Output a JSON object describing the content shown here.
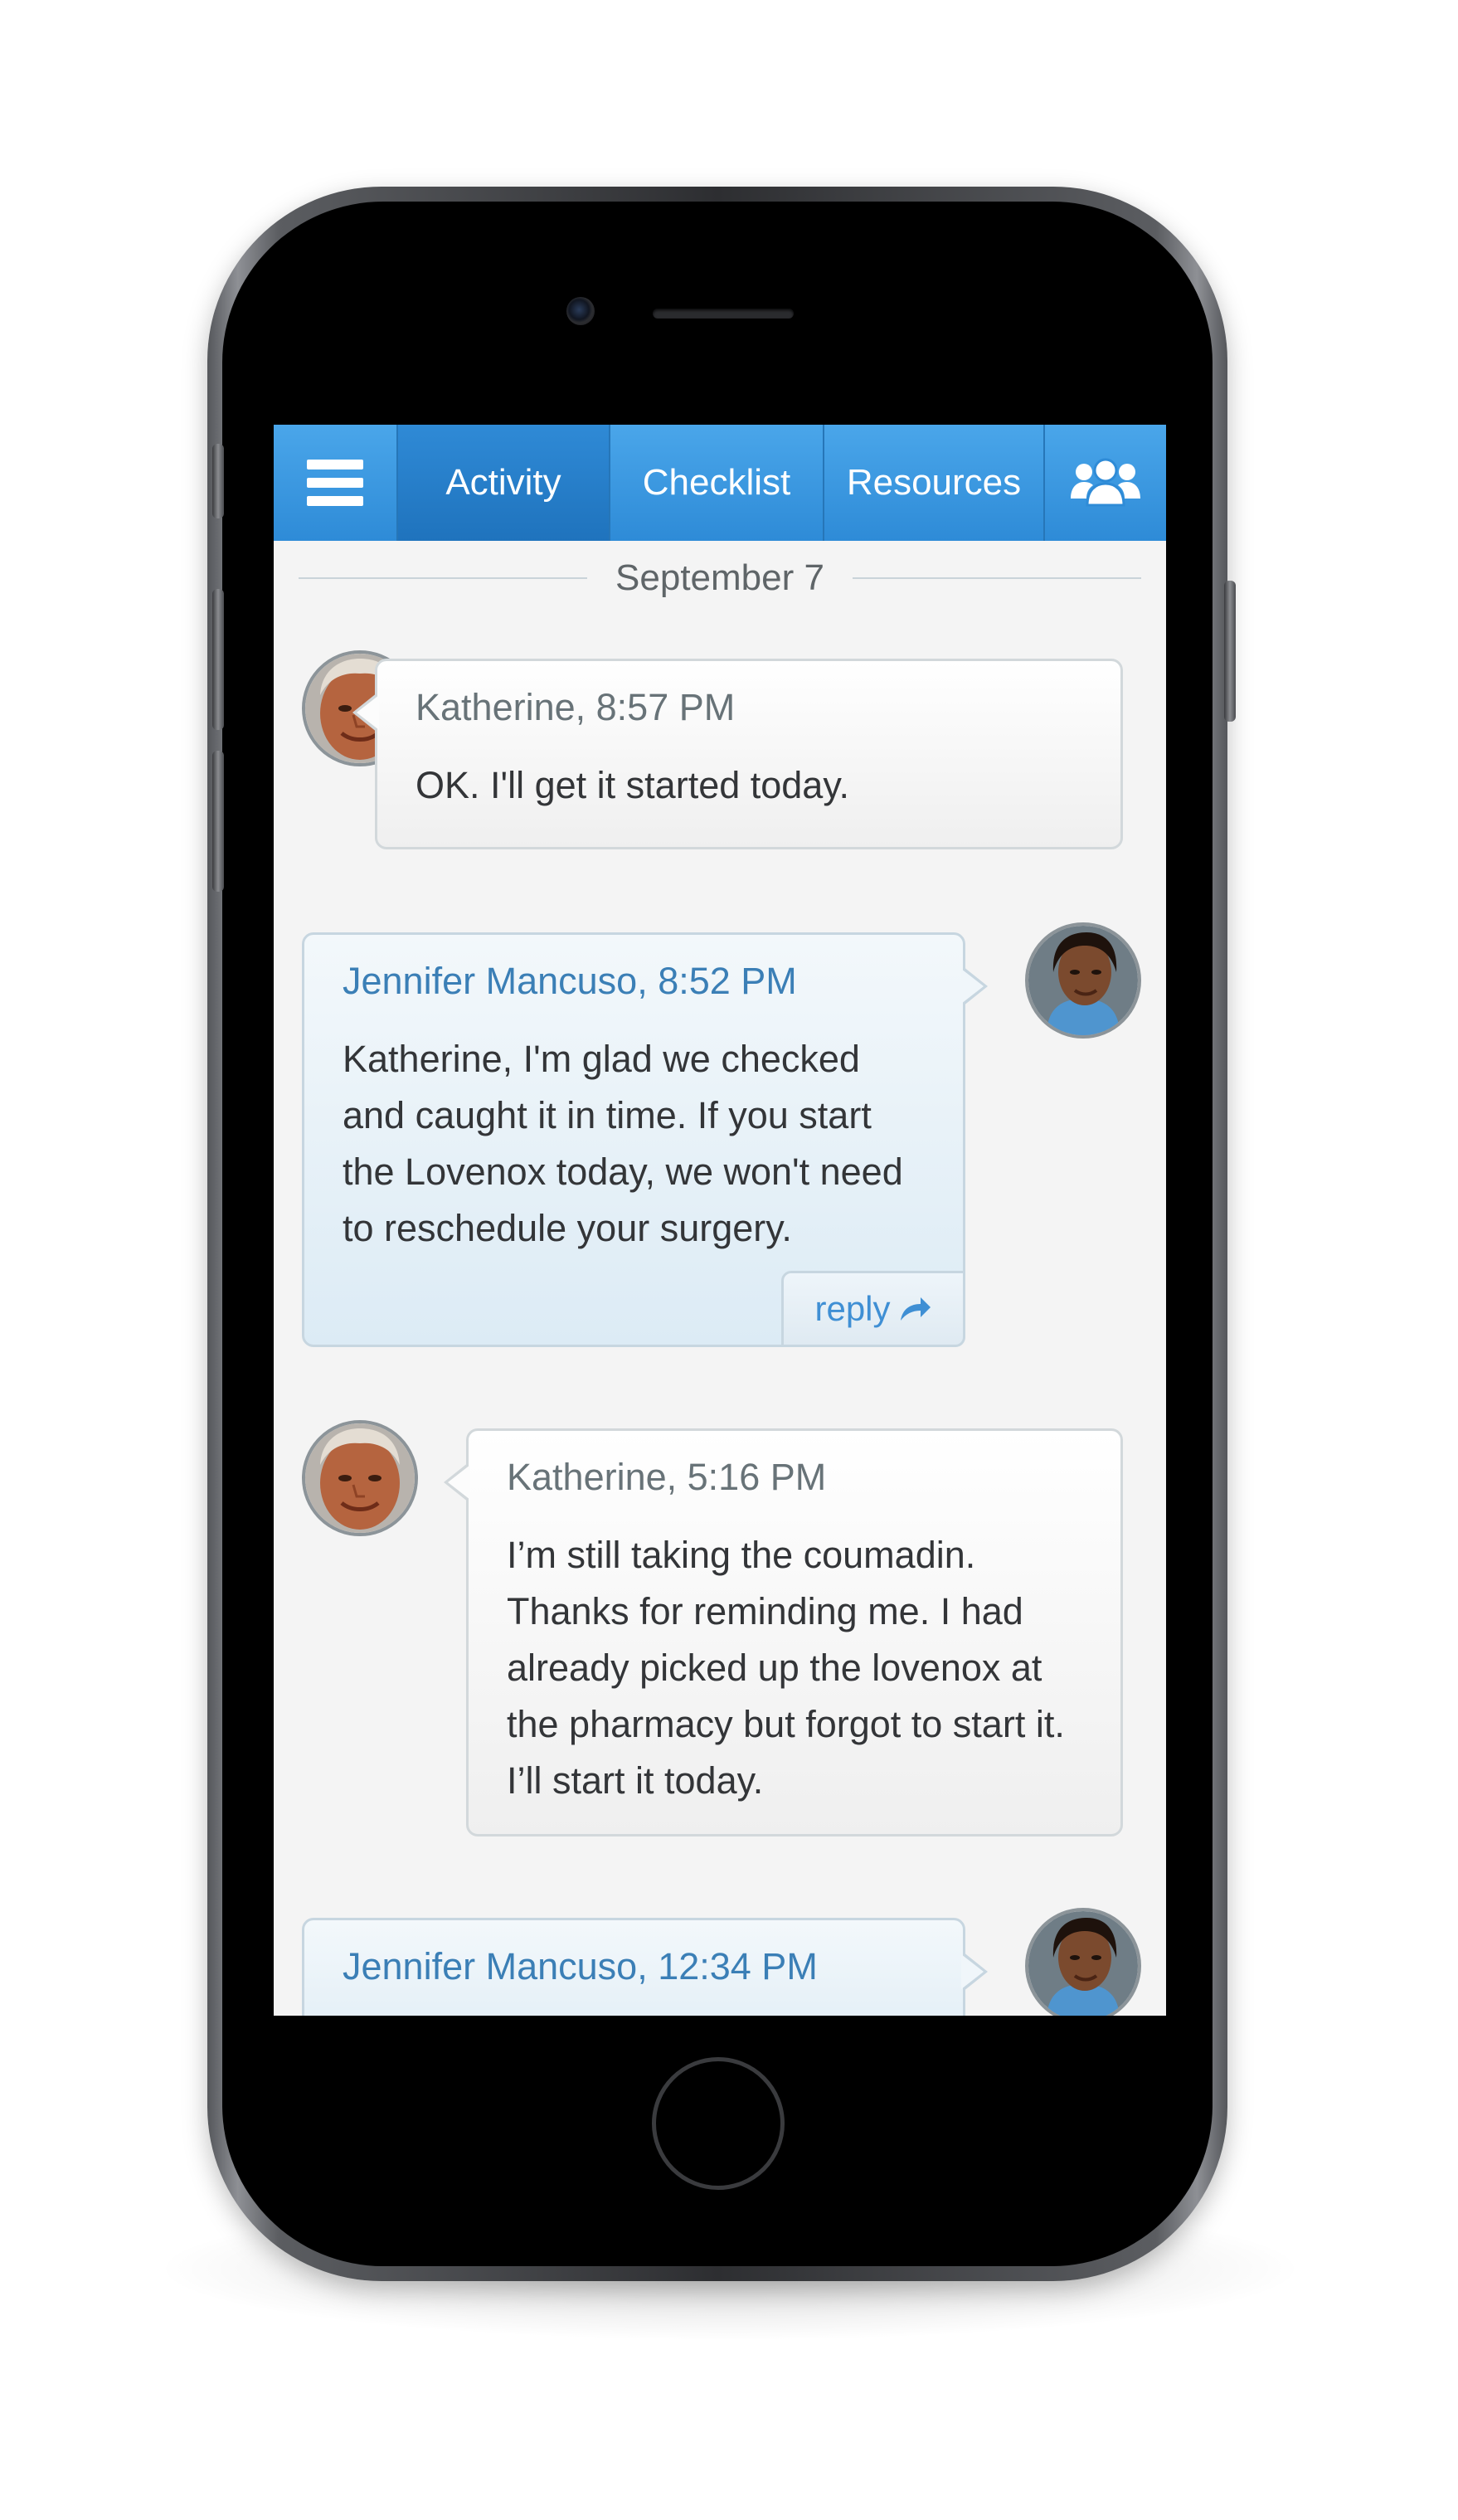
{
  "nav": {
    "menu_icon": "hamburger-menu-icon",
    "tabs": [
      {
        "label": "Activity",
        "active": true
      },
      {
        "label": "Checklist",
        "active": false
      },
      {
        "label": "Resources",
        "active": false
      }
    ],
    "team_icon": "group-icon",
    "color_primary": "#2e8bd7",
    "color_active": "#1f73bd"
  },
  "date_divider": "September 7",
  "messages": [
    {
      "sender": "Katherine, 8:57 PM",
      "text": "OK. I'll get it started today.",
      "side": "left",
      "avatar": "katherine-avatar"
    },
    {
      "sender": "Jennifer Mancuso, 8:52 PM",
      "text": "Katherine, I'm glad we checked and caught it in time. If you start the Lovenox today, we won't need to reschedule your surgery.",
      "side": "right",
      "avatar": "jennifer-avatar",
      "reply_label": "reply",
      "reply_icon": "reply-arrow-icon"
    },
    {
      "sender": "Katherine, 5:16 PM",
      "text": "I’m still taking the coumadin. Thanks for reminding me. I had already picked up the lovenox at the pharmacy but forgot to start it. I’ll start it today.",
      "side": "left",
      "avatar": "katherine-avatar"
    },
    {
      "sender": "Jennifer Mancuso, 12:34 PM",
      "text": "",
      "side": "right",
      "avatar": "jennifer-avatar"
    }
  ]
}
